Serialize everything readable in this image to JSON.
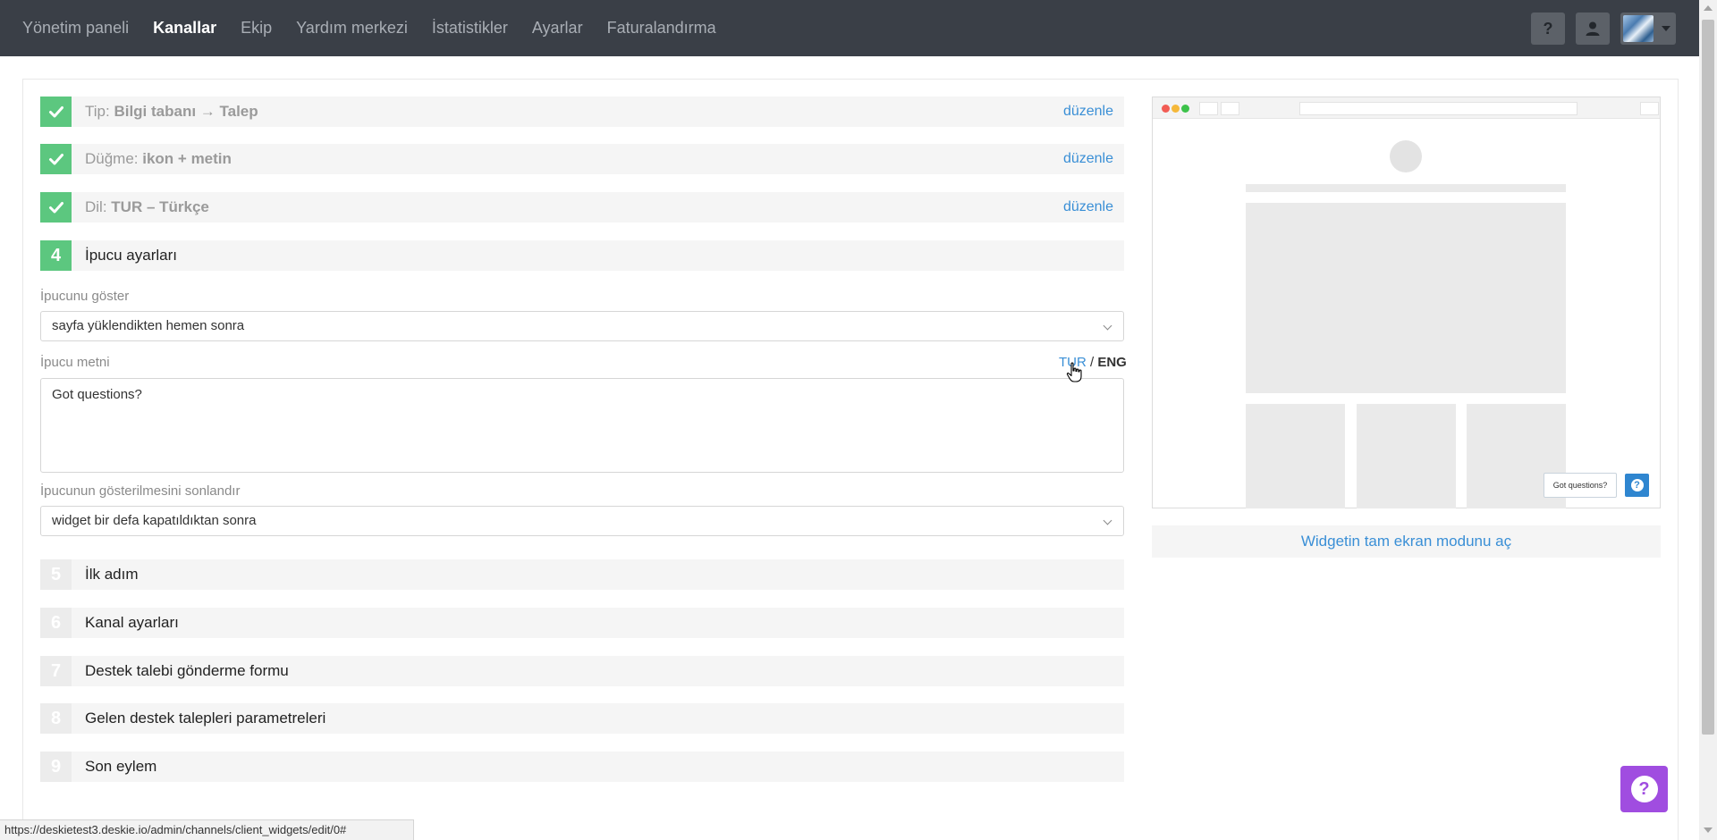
{
  "nav": {
    "items": [
      {
        "label": "Yönetim paneli",
        "active": false
      },
      {
        "label": "Kanallar",
        "active": true
      },
      {
        "label": "Ekip",
        "active": false
      },
      {
        "label": "Yardım merkezi",
        "active": false
      },
      {
        "label": "İstatistikler",
        "active": false
      },
      {
        "label": "Ayarlar",
        "active": false
      },
      {
        "label": "Faturalandırma",
        "active": false
      }
    ],
    "help_label": "?",
    "user_icon": "user-icon",
    "avatar_icon": "avatar-image"
  },
  "steps": {
    "done": [
      {
        "prefix": "Tip: ",
        "value": "Bilgi tabanı → Talep",
        "edit": "düzenle"
      },
      {
        "prefix": "Düğme: ",
        "value": "ikon + metin",
        "edit": "düzenle"
      },
      {
        "prefix": "Dil: ",
        "value": "TUR – Türkçe",
        "edit": "düzenle"
      }
    ],
    "current": {
      "number": "4",
      "label": "İpucu ayarları"
    },
    "todo": [
      {
        "number": "5",
        "label": "İlk adım"
      },
      {
        "number": "6",
        "label": "Kanal ayarları"
      },
      {
        "number": "7",
        "label": "Destek talebi gönderme formu"
      },
      {
        "number": "8",
        "label": "Gelen destek talepleri parametreleri"
      },
      {
        "number": "9",
        "label": "Son eylem"
      }
    ]
  },
  "form": {
    "show_hint_label": "İpucunu göster",
    "show_hint_value": "sayfa yüklendikten hemen sonra",
    "hint_text_label": "İpucu metni",
    "lang_tur": "TUR",
    "lang_sep": " / ",
    "lang_eng": "ENG",
    "hint_text_value": "Got questions?",
    "end_hint_label": "İpucunun gösterilmesini sonlandır",
    "end_hint_value": "widget bir defa kapatıldıktan sonra"
  },
  "preview": {
    "tooltip_text": "Got questions?",
    "help_icon": "question-icon",
    "fullscreen_label": "Widgetin tam ekran modunu aç",
    "dot_colors": [
      "#f25c54",
      "#f5b83a",
      "#3cc24a"
    ]
  },
  "float_help_icon": "question-icon",
  "status_url": "https://deskietest3.deskie.io/admin/channels/client_widgets/edit/0#",
  "colors": {
    "topbar": "#3a3f47",
    "accent": "#3a8fd6",
    "success": "#5cc77f",
    "float_help": "#a04de0"
  }
}
